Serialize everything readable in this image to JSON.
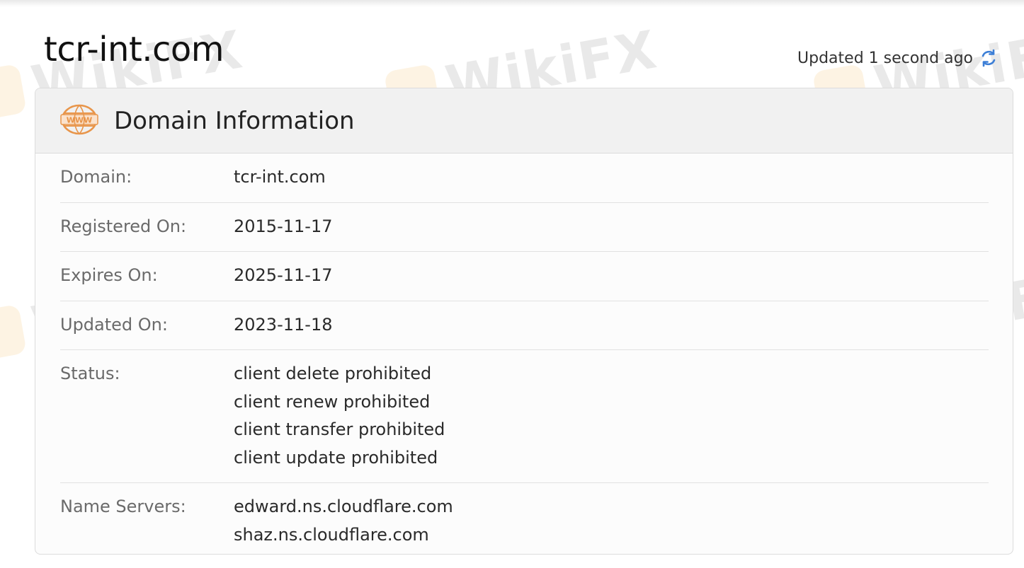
{
  "header": {
    "domain_title": "tcr-int.com",
    "updated_text": "Updated 1 second ago"
  },
  "card": {
    "title": "Domain Information",
    "rows": [
      {
        "label": "Domain:",
        "values": [
          "tcr-int.com"
        ]
      },
      {
        "label": "Registered On:",
        "values": [
          "2015-11-17"
        ]
      },
      {
        "label": "Expires On:",
        "values": [
          "2025-11-17"
        ]
      },
      {
        "label": "Updated On:",
        "values": [
          "2023-11-18"
        ]
      },
      {
        "label": "Status:",
        "values": [
          "client delete prohibited",
          "client renew prohibited",
          "client transfer prohibited",
          "client update prohibited"
        ]
      },
      {
        "label": "Name Servers:",
        "values": [
          "edward.ns.cloudflare.com",
          "shaz.ns.cloudflare.com"
        ]
      }
    ]
  },
  "watermark": {
    "text": "WikiFX"
  },
  "colors": {
    "icon_orange": "#e8954a",
    "refresh_blue": "#3d7fd6"
  }
}
